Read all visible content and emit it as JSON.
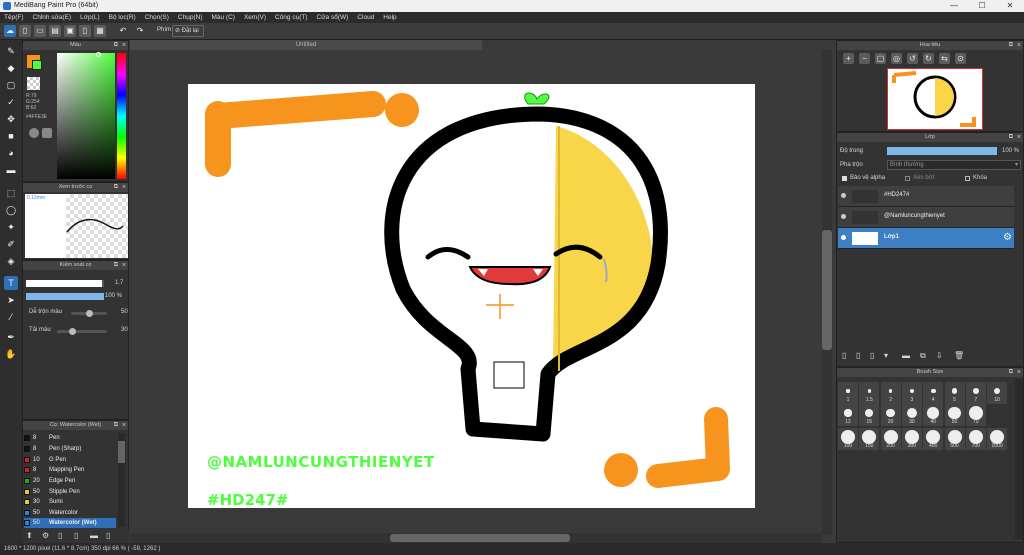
{
  "window": {
    "title": "MediBang Paint Pro (64bit)",
    "minimize": "—",
    "maximize": "☐",
    "close": "✕"
  },
  "menu": [
    "Tệp(F)",
    "Chỉnh sửa(E)",
    "Lớp(L)",
    "Bộ lọc(R)",
    "Chọn(S)",
    "Chụp(N)",
    "Màu (C)",
    "Xem(V)",
    "Công cụ(T)",
    "Cửa sổ(W)",
    "Cloud",
    "Help"
  ],
  "toolbar": {
    "keys_label": "Phím",
    "reset_label": "Đặt lại"
  },
  "color_panel": {
    "title": "Màu",
    "r": "R:79",
    "g": "G:254",
    "b": "B:62",
    "hex": "#4FFE3E"
  },
  "brush_preview": {
    "title": "Xem trước cọ",
    "size": "0.12mm"
  },
  "brush_control": {
    "title": "Kiểm soát cọ",
    "size_value": "1.7",
    "opacity_value": "100 %",
    "blend_label": "Dễ trộn màu",
    "blend_value": "50",
    "reload_label": "Tải màu",
    "reload_value": "30",
    "size_fill": 0.98,
    "opacity_fill": 1.0,
    "blend_level": 0.5,
    "reload_level": 0.3
  },
  "brush_list": {
    "title": "Cọ: Watercolor (Wet)",
    "items": [
      {
        "size": "8",
        "name": "Pen",
        "color": "#111111"
      },
      {
        "size": "8",
        "name": "Pen (Sharp)",
        "color": "#111111"
      },
      {
        "size": "10",
        "name": "G Pen",
        "color": "#cc2222"
      },
      {
        "size": "8",
        "name": "Mapping Pen",
        "color": "#cc2222"
      },
      {
        "size": "20",
        "name": "Edge Pen",
        "color": "#22aa22"
      },
      {
        "size": "50",
        "name": "Stipple Pen",
        "color": "#ddcc22"
      },
      {
        "size": "30",
        "name": "Sumi",
        "color": "#ddcc22"
      },
      {
        "size": "50",
        "name": "Watercolor",
        "color": "#2288dd"
      },
      {
        "size": "50",
        "name": "Watercolor (Wet)",
        "color": "#2288dd"
      }
    ]
  },
  "document": {
    "tab": "Untitled",
    "watermark_name": "@NAMLUNCUNGTHIENYET",
    "watermark_tag": "#HD247#"
  },
  "navigator": {
    "title": "Hoa tiêu"
  },
  "layers": {
    "title": "Lớp",
    "opacity_label": "Độ trong",
    "opacity_value": "100 %",
    "blend_label": "Pha trộn",
    "blend_value": "Bình thường",
    "protect_alpha": "Bảo vệ alpha",
    "clipping": "Xén bớt",
    "lock": "Khóa",
    "items": [
      {
        "name": "#HD247#",
        "selected": false
      },
      {
        "name": "@Namluncungthienyet",
        "selected": false
      },
      {
        "name": "Lớp1",
        "selected": true
      }
    ]
  },
  "brush_size": {
    "title": "Brush Size",
    "row1": [
      "1",
      "1.5",
      "2",
      "3",
      "4",
      "5",
      "7",
      "10"
    ],
    "row2": [
      "12",
      "15",
      "20",
      "30",
      "40",
      "50",
      "70"
    ],
    "row3": [
      "100",
      "150",
      "200",
      "300",
      "400",
      "500",
      "700",
      "1000"
    ]
  },
  "status": {
    "text": "1600 * 1200 pixel   (11.6 * 8.7cm)   350 dpi   66 %   ( -59, 1262 )"
  },
  "colors": {
    "accent": "#4FFE3E",
    "orange": "#F7941D",
    "yellow": "#F9D54A",
    "selected_layer": "#3d7fc4"
  }
}
